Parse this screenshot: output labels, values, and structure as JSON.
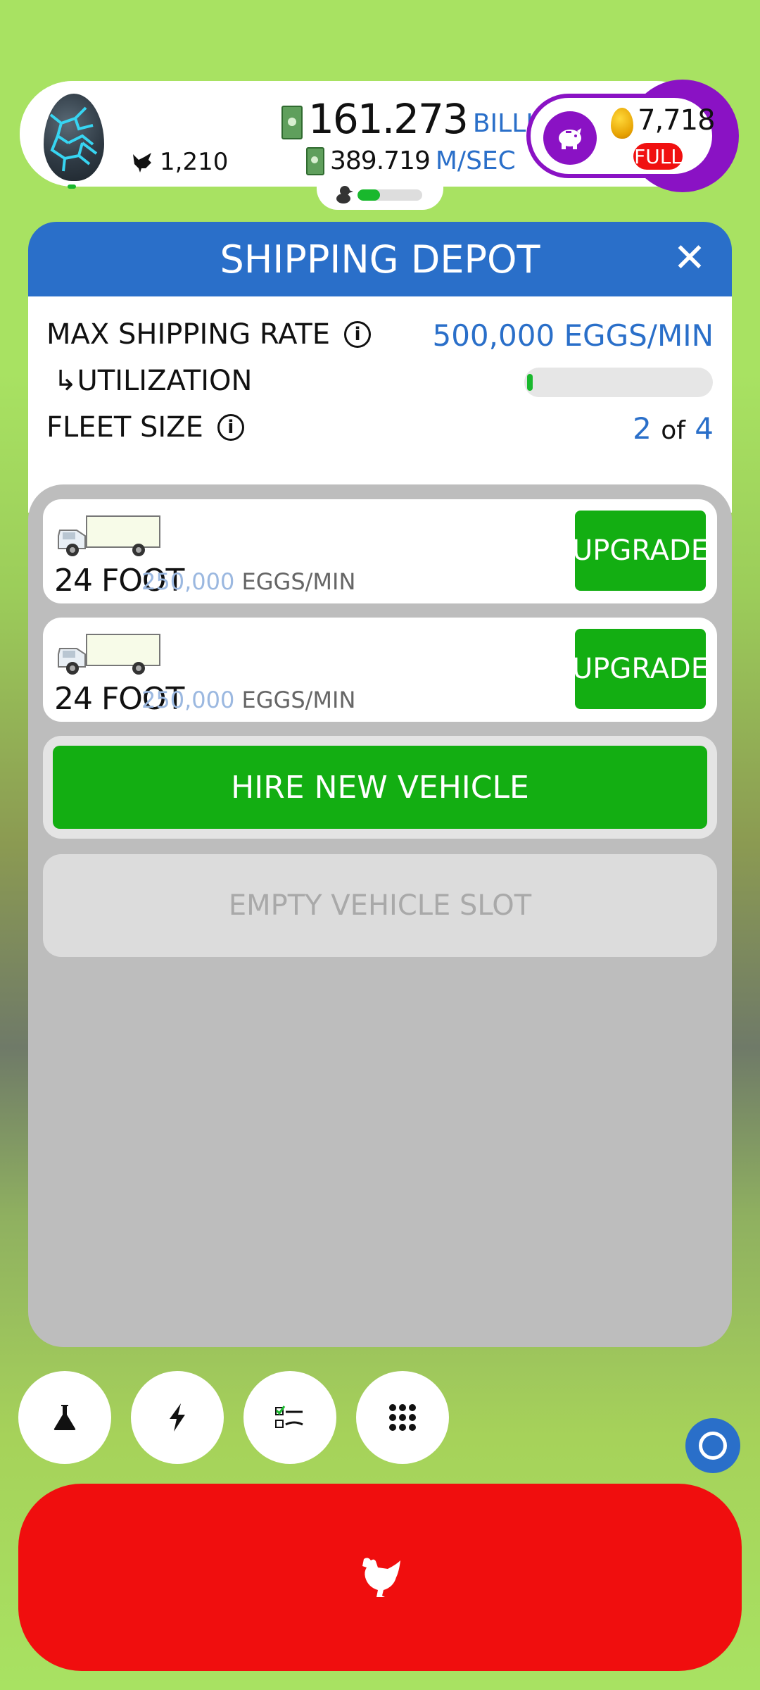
{
  "hud": {
    "chicken_count": "1,210",
    "money_amount": "161.273",
    "money_unit": "BILLION",
    "rate_amount": "389.719",
    "rate_unit": "M/SEC",
    "hatchery_fill_percent": 35,
    "golden_eggs": "7,718",
    "piggy_status": "FULL"
  },
  "panel": {
    "title": "SHIPPING DEPOT",
    "max_shipping_rate_label": "MAX SHIPPING RATE",
    "max_shipping_rate_value": "500,000 EGGS/MIN",
    "utilization_label": "↳UTILIZATION",
    "utilization_percent": 2,
    "fleet_size_label": "FLEET SIZE",
    "fleet_size_current": "2",
    "fleet_size_of": "of",
    "fleet_size_max": "4"
  },
  "vehicles": [
    {
      "name": "24 FOOT",
      "rate": "250,000",
      "rate_unit": "EGGS/MIN",
      "button": "UPGRADE"
    },
    {
      "name": "24 FOOT",
      "rate": "250,000",
      "rate_unit": "EGGS/MIN",
      "button": "UPGRADE"
    }
  ],
  "hire_button": "HIRE NEW VEHICLE",
  "empty_slot": "EMPTY VEHICLE SLOT",
  "toolbar": {
    "icons": [
      "flask-icon",
      "lightning-icon",
      "checklist-icon",
      "grid-menu-icon"
    ]
  },
  "colors": {
    "header_blue": "#2a6fc9",
    "button_green": "#13ae12",
    "hatch_red": "#f00e0e",
    "golden_purple": "#8a12c4"
  }
}
